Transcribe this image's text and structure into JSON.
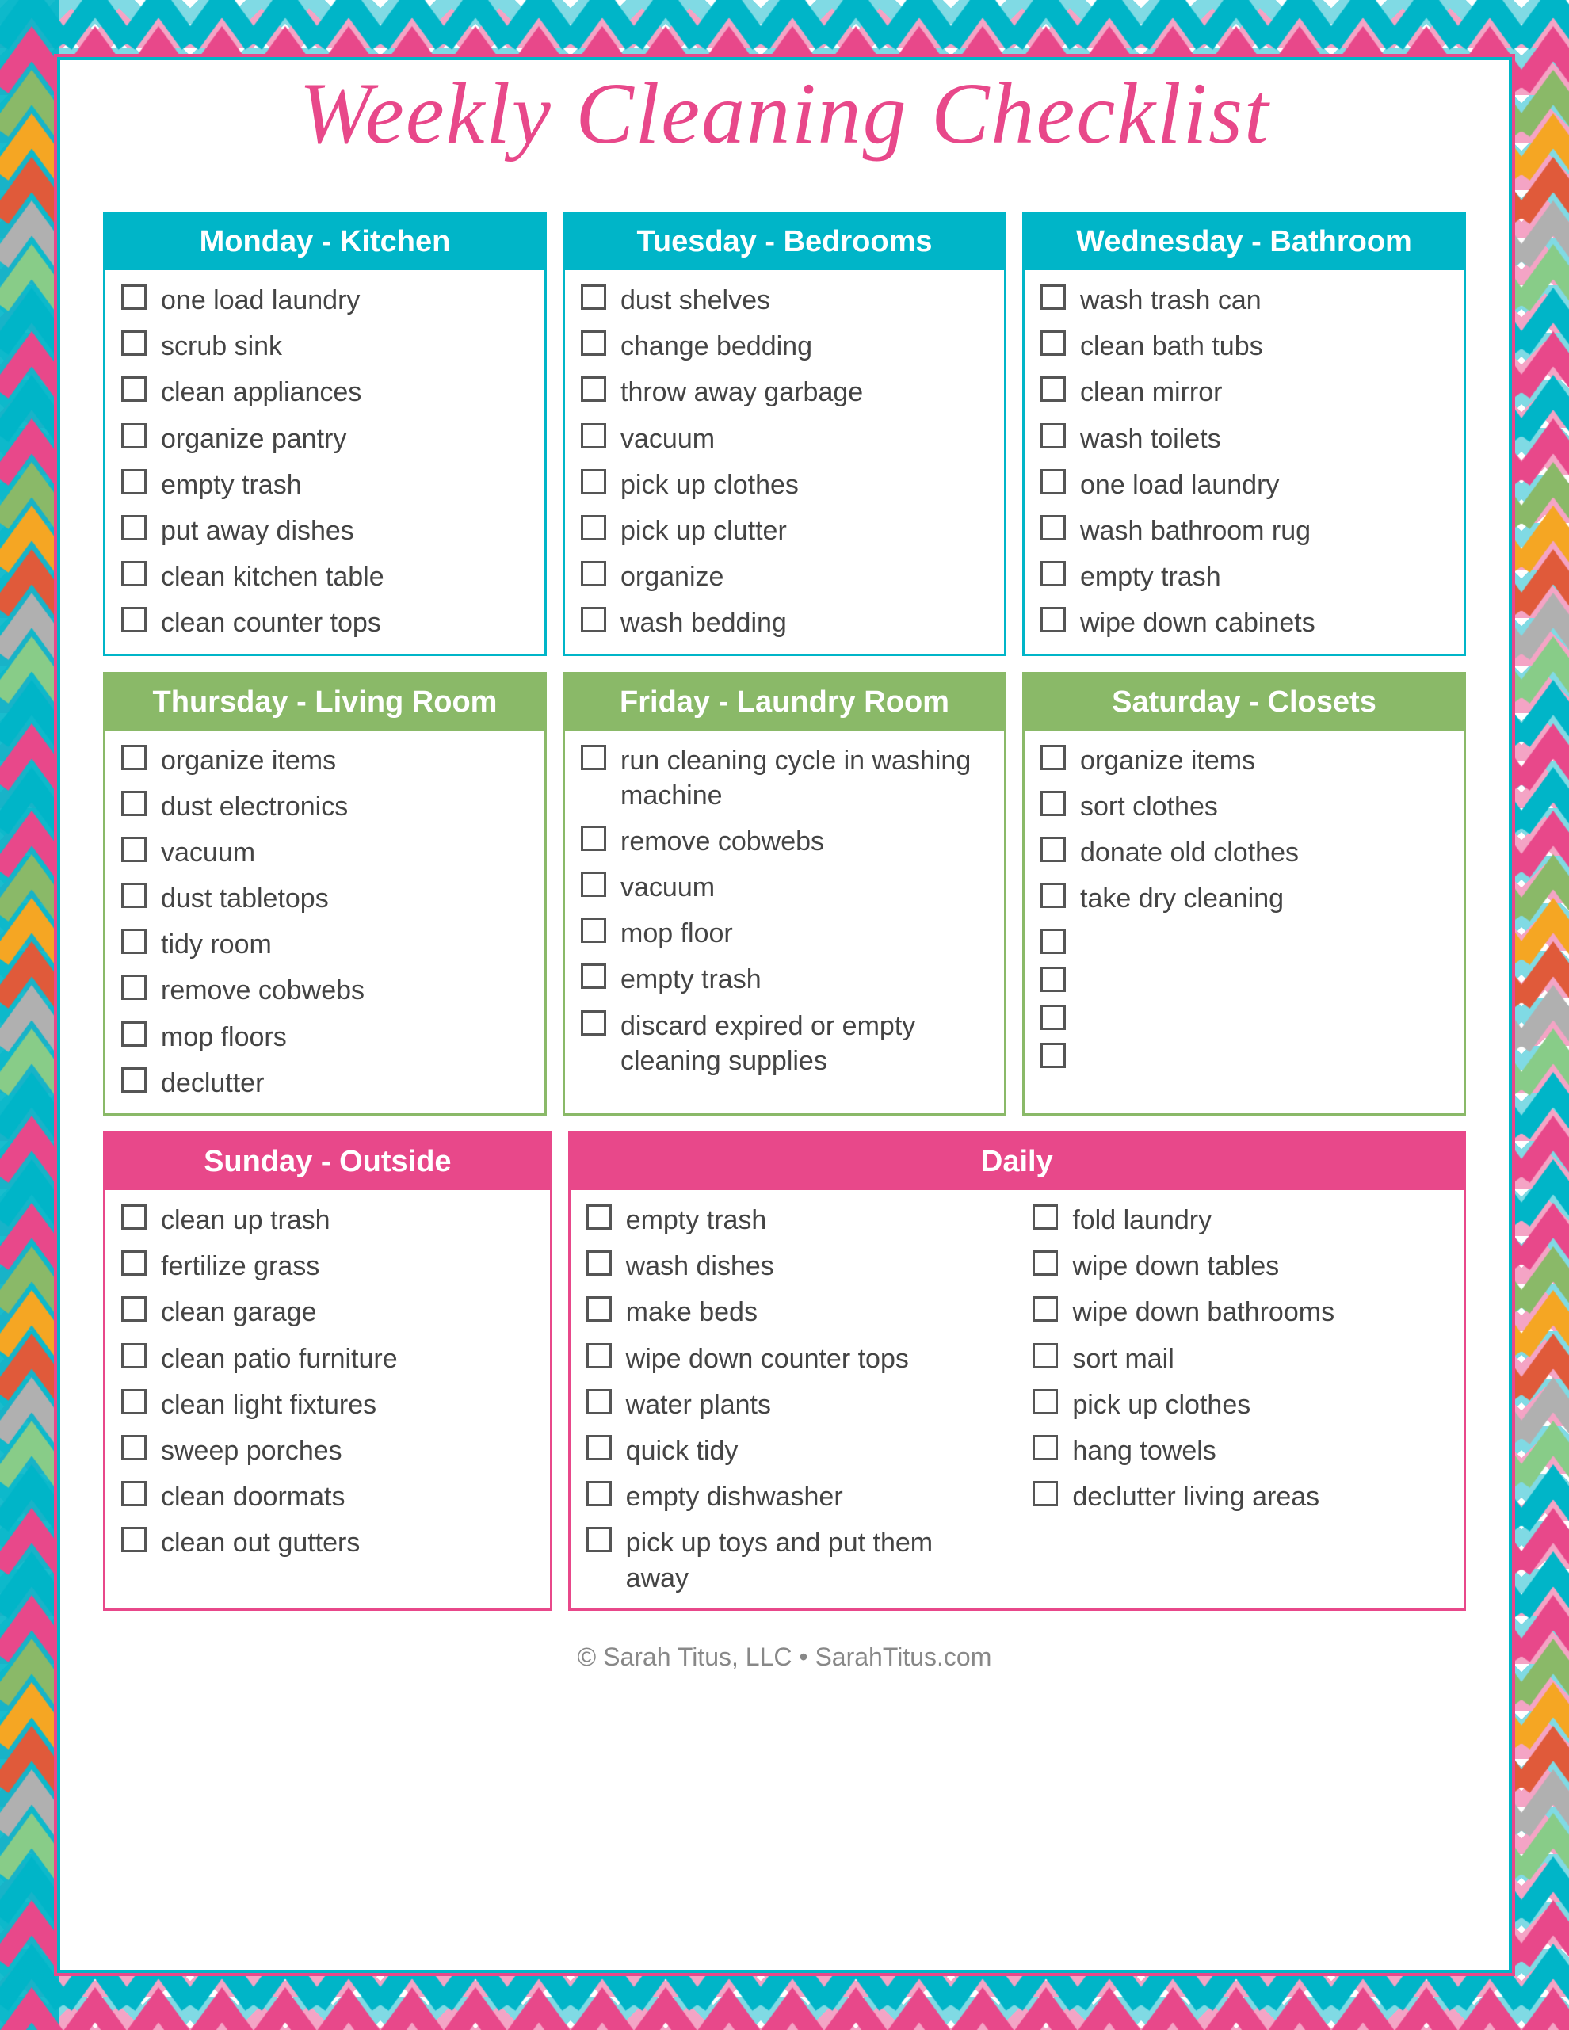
{
  "title": "Weekly Cleaning Checklist",
  "footer": "© Sarah Titus, LLC • SarahTitus.com",
  "sections": {
    "monday": {
      "label": "Monday - Kitchen",
      "items": [
        "one load laundry",
        "scrub sink",
        "clean appliances",
        "organize pantry",
        "empty trash",
        "put away dishes",
        "clean kitchen table",
        "clean counter tops"
      ]
    },
    "tuesday": {
      "label": "Tuesday - Bedrooms",
      "items": [
        "dust shelves",
        "change bedding",
        "throw away garbage",
        "vacuum",
        "pick up clothes",
        "pick up clutter",
        "organize",
        "wash bedding"
      ]
    },
    "wednesday": {
      "label": "Wednesday - Bathroom",
      "items": [
        "wash trash can",
        "clean bath tubs",
        "clean mirror",
        "wash toilets",
        "one load laundry",
        "wash bathroom rug",
        "empty trash",
        "wipe down cabinets"
      ]
    },
    "thursday": {
      "label": "Thursday - Living Room",
      "items": [
        "organize items",
        "dust electronics",
        "vacuum",
        "dust tabletops",
        "tidy room",
        "remove cobwebs",
        "mop floors",
        "declutter"
      ]
    },
    "friday": {
      "label": "Friday - Laundry Room",
      "items": [
        "run cleaning cycle in washing machine",
        "remove cobwebs",
        "vacuum",
        "mop floor",
        "empty trash",
        "discard expired or empty cleaning supplies"
      ]
    },
    "saturday": {
      "label": "Saturday - Closets",
      "items": [
        "organize items",
        "sort clothes",
        "donate old clothes",
        "take dry cleaning",
        "",
        "",
        "",
        ""
      ]
    },
    "sunday": {
      "label": "Sunday - Outside",
      "items": [
        "clean up trash",
        "fertilize grass",
        "clean garage",
        "clean patio furniture",
        "clean light fixtures",
        "sweep porches",
        "clean doormats",
        "clean out gutters"
      ]
    },
    "daily": {
      "label": "Daily",
      "col1": [
        "empty trash",
        "wash dishes",
        "make beds",
        "wipe down counter tops",
        "water plants",
        "quick tidy",
        "empty dishwasher",
        "pick up toys and put them away"
      ],
      "col2": [
        "fold laundry",
        "wipe down tables",
        "wipe down bathrooms",
        "sort mail",
        "pick up clothes",
        "hang towels",
        "declutter living areas"
      ]
    }
  }
}
